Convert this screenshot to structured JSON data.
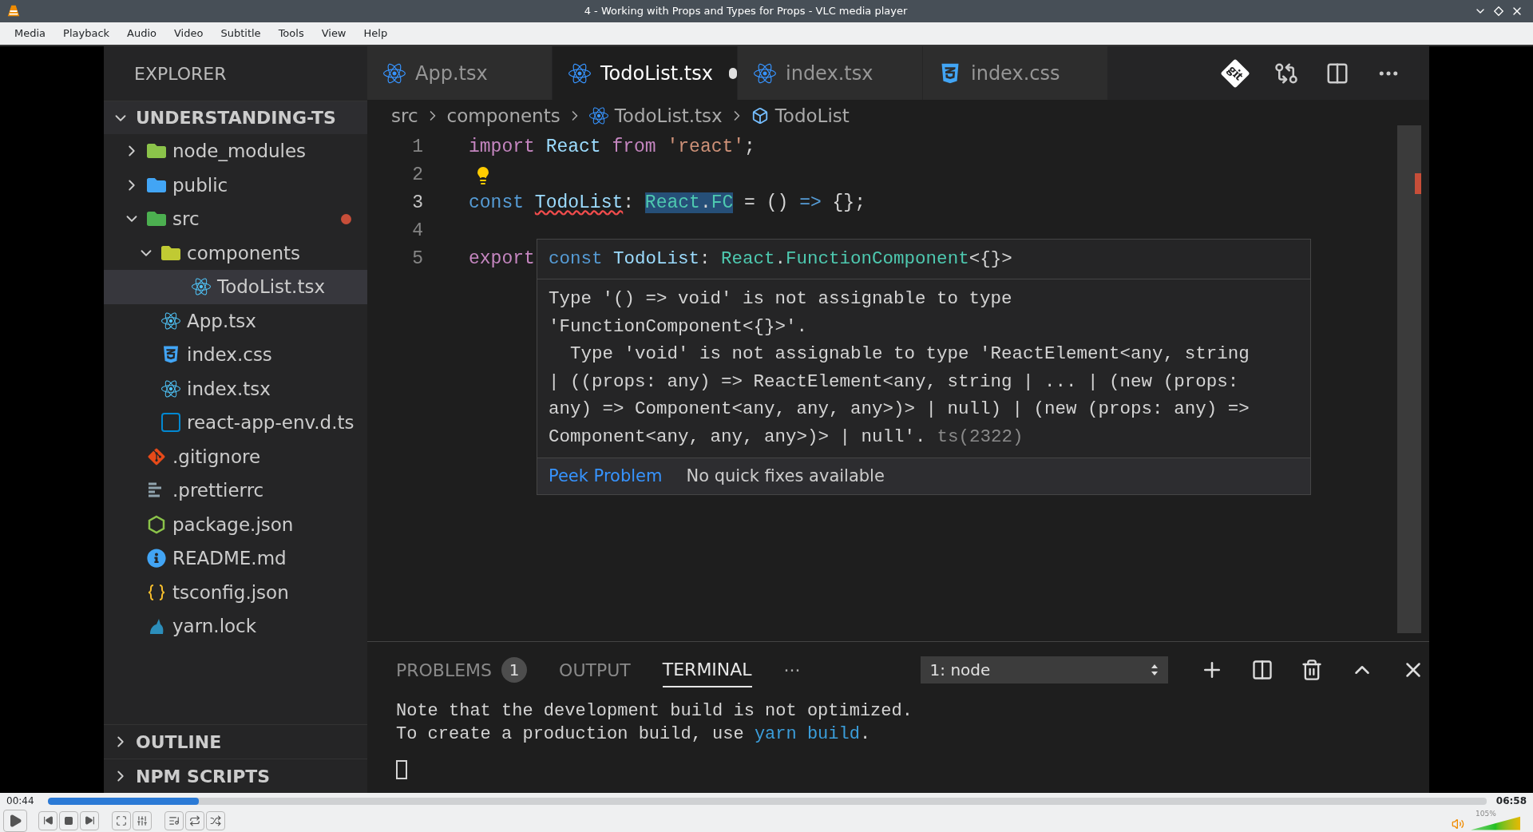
{
  "window": {
    "title": "4 - Working with Props and Types for Props - VLC media player"
  },
  "menu": [
    "Media",
    "Playback",
    "Audio",
    "Video",
    "Subtitle",
    "Tools",
    "View",
    "Help"
  ],
  "explorer": {
    "title": "EXPLORER",
    "project": {
      "label": "UNDERSTANDING-TS",
      "expanded": true
    },
    "tree": [
      {
        "label": "node_modules",
        "kind": "folder-modules",
        "expanded": false,
        "selected": false
      },
      {
        "label": "public",
        "kind": "folder-public",
        "expanded": false,
        "selected": false
      },
      {
        "label": "src",
        "kind": "folder-src",
        "expanded": true,
        "selected": false,
        "modified": true,
        "children": [
          {
            "label": "components",
            "kind": "folder-components",
            "expanded": true,
            "selected": false,
            "children": [
              {
                "label": "TodoList.tsx",
                "kind": "react",
                "selected": true
              }
            ]
          },
          {
            "label": "App.tsx",
            "kind": "react",
            "selected": false
          },
          {
            "label": "index.css",
            "kind": "css",
            "selected": false
          },
          {
            "label": "index.tsx",
            "kind": "react",
            "selected": false
          },
          {
            "label": "react-app-env.d.ts",
            "kind": "ts",
            "selected": false
          }
        ]
      },
      {
        "label": ".gitignore",
        "kind": "git",
        "selected": false
      },
      {
        "label": ".prettierrc",
        "kind": "prettier",
        "selected": false
      },
      {
        "label": "package.json",
        "kind": "json",
        "selected": false
      },
      {
        "label": "README.md",
        "kind": "info",
        "selected": false
      },
      {
        "label": "tsconfig.json",
        "kind": "braces",
        "selected": false
      },
      {
        "label": "yarn.lock",
        "kind": "yarn",
        "selected": false
      }
    ],
    "sections": [
      {
        "label": "OUTLINE",
        "expanded": false
      },
      {
        "label": "NPM SCRIPTS",
        "expanded": false
      }
    ]
  },
  "tabs": [
    {
      "label": "App.tsx",
      "kind": "react",
      "selected": false,
      "modified": false
    },
    {
      "label": "TodoList.tsx",
      "kind": "react",
      "selected": true,
      "modified": true
    },
    {
      "label": "index.tsx",
      "kind": "react",
      "selected": false,
      "modified": false
    },
    {
      "label": "index.css",
      "kind": "css",
      "selected": false,
      "modified": false
    }
  ],
  "breadcrumb": [
    {
      "label": "src",
      "kind": "folder"
    },
    {
      "label": "components",
      "kind": "folder"
    },
    {
      "label": "TodoList.tsx",
      "kind": "react"
    },
    {
      "label": "TodoList",
      "kind": "symbol"
    }
  ],
  "code": [
    {
      "number": "1",
      "tokens": [
        {
          "text": "import ",
          "kind": "control"
        },
        {
          "text": "React ",
          "kind": "var"
        },
        {
          "text": "from ",
          "kind": "control"
        },
        {
          "text": "'react'",
          "kind": "string"
        },
        {
          "text": ";",
          "kind": "plain"
        }
      ]
    },
    {
      "number": "2",
      "lightbulb": true
    },
    {
      "number": "3",
      "tokens": [
        {
          "text": "const ",
          "kind": "keyword"
        },
        {
          "text": "TodoList",
          "kind": "var",
          "error": true
        },
        {
          "text": ": ",
          "kind": "plain"
        },
        {
          "text": "React",
          "kind": "type",
          "highlight": true
        },
        {
          "text": ".",
          "kind": "plain",
          "highlight": true
        },
        {
          "text": "FC",
          "kind": "type",
          "highlight": true
        },
        {
          "text": " = () ",
          "kind": "plain"
        },
        {
          "text": "=>",
          "kind": "keyword"
        },
        {
          "text": " {};",
          "kind": "plain"
        }
      ]
    },
    {
      "number": "4"
    },
    {
      "number": "5",
      "tokens": [
        {
          "text": "export",
          "kind": "control"
        }
      ]
    }
  ],
  "hover": {
    "signature": [
      {
        "text": "const ",
        "kind": "keyword"
      },
      {
        "text": "TodoList",
        "kind": "var"
      },
      {
        "text": ": ",
        "kind": "plain"
      },
      {
        "text": "React",
        "kind": "type"
      },
      {
        "text": ".",
        "kind": "plain"
      },
      {
        "text": "FunctionComponent",
        "kind": "type"
      },
      {
        "text": "<{}>",
        "kind": "plain"
      }
    ],
    "message": [
      "Type '() => void' is not assignable to type",
      "'FunctionComponent<{}>'.",
      "  Type 'void' is not assignable to type 'ReactElement<any, string",
      "| ((props: any) => ReactElement<any, string | ... | (new (props:",
      "any) => Component<any, any, any>)> | null) | (new (props: any) =>",
      "Component<any, any, any>)> | null'."
    ],
    "code": "ts(2322)",
    "action": "Peek Problem",
    "note": "No quick fixes available"
  },
  "panel": {
    "tabs": [
      {
        "label": "PROBLEMS",
        "badge": "1",
        "selected": false
      },
      {
        "label": "OUTPUT",
        "selected": false
      },
      {
        "label": "TERMINAL",
        "selected": true
      }
    ],
    "more": "···",
    "terminal_select": "1: node",
    "terminal": [
      [
        {
          "text": "Note that the development build is not optimized.",
          "kind": "plain"
        }
      ],
      [
        {
          "text": "To create a production build, use ",
          "kind": "plain"
        },
        {
          "text": "yarn build",
          "kind": "command"
        },
        {
          "text": ".",
          "kind": "plain"
        }
      ]
    ]
  },
  "player": {
    "elapsed": "00:44",
    "total": "06:58",
    "progress": {
      "level": 0.105
    },
    "volume": {
      "reading": "105%",
      "level": 0.84
    }
  }
}
